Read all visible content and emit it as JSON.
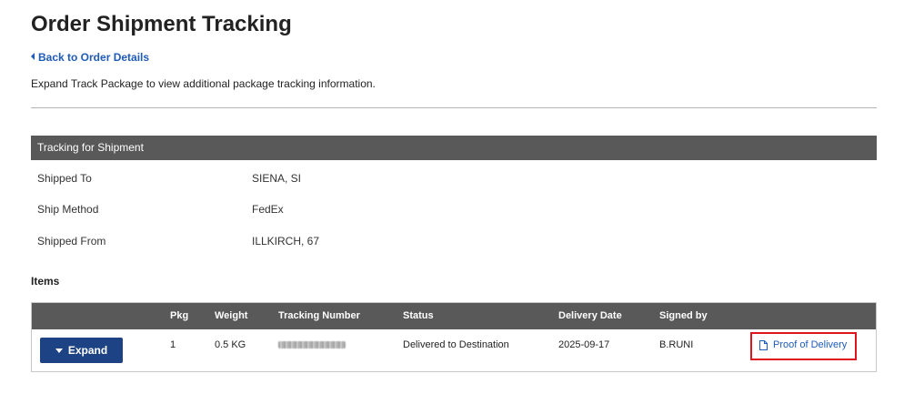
{
  "page": {
    "title": "Order Shipment Tracking",
    "back_link": "Back to Order Details",
    "instructions": "Expand Track Package to view additional package tracking information."
  },
  "shipment": {
    "header": "Tracking for Shipment",
    "rows": [
      {
        "label": "Shipped To",
        "value": "SIENA, SI"
      },
      {
        "label": "Ship Method",
        "value": "FedEx"
      },
      {
        "label": "Shipped From",
        "value": "ILLKIRCH, 67"
      }
    ]
  },
  "items": {
    "heading": "Items",
    "columns": {
      "pkg": "Pkg",
      "weight": "Weight",
      "tracking_number": "Tracking Number",
      "status": "Status",
      "delivery_date": "Delivery Date",
      "signed_by": "Signed by"
    },
    "rows": [
      {
        "expand_label": "Expand",
        "pkg": "1",
        "weight": "0.5 KG",
        "tracking_number_redacted": true,
        "status": "Delivered to Destination",
        "delivery_date": "2025-09-17",
        "signed_by": "B.RUNI",
        "proof_label": "Proof of Delivery"
      }
    ]
  },
  "icons": {
    "back": "caret-left-icon",
    "expand": "caret-down-icon",
    "proof": "document-icon"
  },
  "colors": {
    "link": "#1e5bb8",
    "header_bg": "#595959",
    "button_bg": "#1d4385",
    "highlight": "#e0141e"
  }
}
